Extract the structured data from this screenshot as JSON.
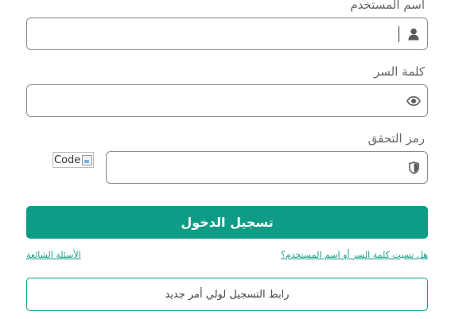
{
  "username": {
    "label": "اسم المستخدم",
    "value": "",
    "icon": "user-icon"
  },
  "password": {
    "label": "كلمة السر",
    "value": "",
    "icon": "eye-icon"
  },
  "captcha": {
    "label": "رمز التحقق",
    "value": "",
    "icon": "shield-icon",
    "image_alt": "Code"
  },
  "actions": {
    "login_label": "تسجيل الدخول",
    "forgot_label": "هل نسيت كلمة السر أو اسم المستخدم؟",
    "faq_label": "الأسئلة الشائعة",
    "register_label": "رابط التسجيل لولي أمر جديد"
  },
  "colors": {
    "accent": "#0e9c86",
    "border": "#8a8a8a",
    "label_text": "#666666"
  }
}
